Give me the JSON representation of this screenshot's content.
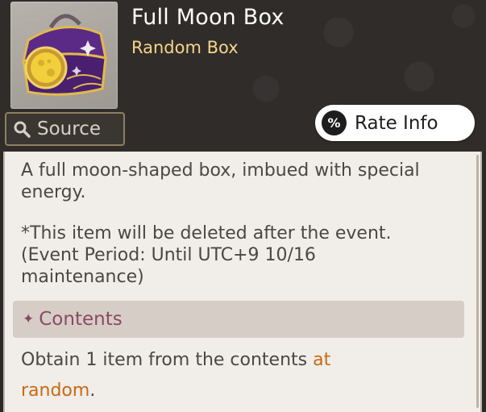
{
  "item": {
    "name": "Full Moon Box",
    "category": "Random Box",
    "icon": "full-moon-box-icon"
  },
  "buttons": {
    "source_label": "Source",
    "source_icon": "search-icon",
    "rate_label": "Rate Info",
    "rate_icon": "percent-icon",
    "rate_icon_glyph": "%"
  },
  "description": {
    "line1": "A full moon-shaped box, imbued with special",
    "line2": "energy.",
    "notice_line1": "*This item will be deleted after the event.",
    "notice_line2": "(Event Period: Until UTC+9 10/16",
    "notice_line3": "maintenance)"
  },
  "contents": {
    "header": "Contents",
    "header_icon": "sparkle-icon",
    "text_before": "Obtain 1 item from the contents ",
    "text_highlight_1": "at",
    "text_highlight_2": "random",
    "text_after": "."
  },
  "colors": {
    "title": "#ffffff",
    "subtitle": "#f4d58a",
    "contents_accent": "#8a4a63",
    "highlight": "#c86a14"
  }
}
